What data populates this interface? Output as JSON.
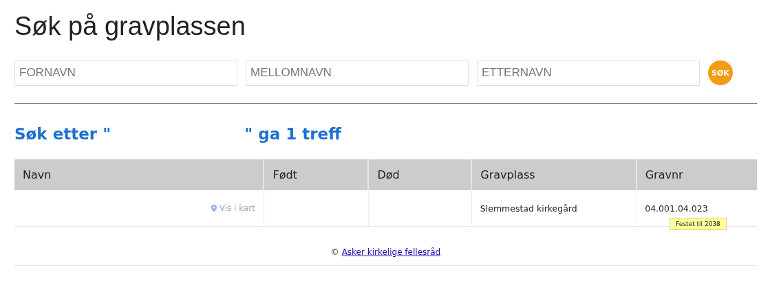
{
  "title": "Søk på gravplassen",
  "search": {
    "fields": [
      {
        "placeholder": "FORNAVN"
      },
      {
        "placeholder": "MELLOMNAVN"
      },
      {
        "placeholder": "ETTERNAVN"
      }
    ],
    "button": "SØK"
  },
  "result_heading": {
    "before": "Søk etter \"",
    "after": "\" ga 1 treff"
  },
  "table": {
    "columns": [
      "Navn",
      "Født",
      "Død",
      "Gravplass",
      "Gravnr"
    ],
    "rows": [
      {
        "map_link": "Vis i kart",
        "gravplass": "Slemmestad kirkegård",
        "gravnr": "04.001.04.023",
        "tooltip": "Festet til 2038"
      }
    ]
  },
  "footer": {
    "symbol": "©",
    "link": "Asker kirkelige fellesråd"
  }
}
